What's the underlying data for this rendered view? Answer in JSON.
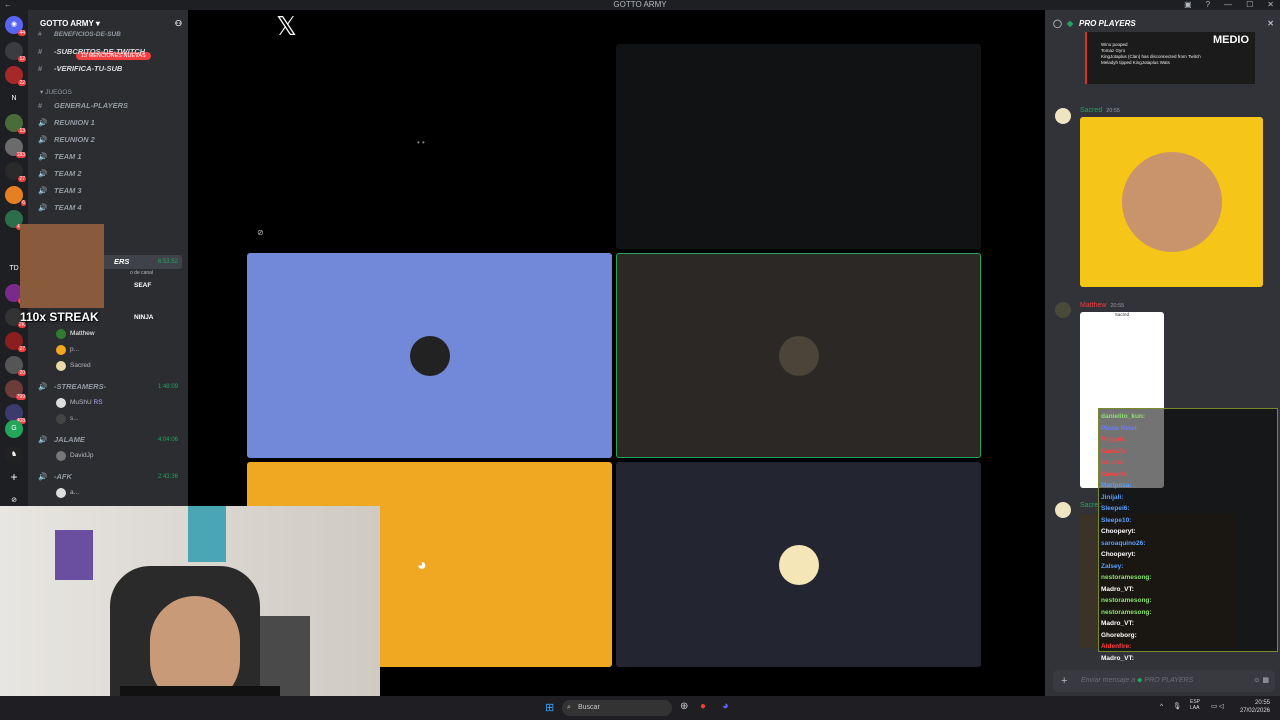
{
  "window": {
    "title": "GOTTO ARMY"
  },
  "server_rail": {
    "badges": [
      "44",
      "12",
      "22",
      "N",
      "13",
      "183",
      "27",
      "6",
      "411",
      "TD",
      "24",
      "2K",
      "27",
      "20",
      "799",
      "408"
    ]
  },
  "channels": {
    "server_name": "GOTTO ARMY",
    "mention_pill": "13 MENCIONES NUEVAS",
    "top_channels": [
      "BENEFICIOS-DE-SUB",
      "-SUBCRITOS-DE-TWITCH",
      "-VERIFICA-TU-SUB"
    ],
    "category": "JUEGOS",
    "text_channels": [
      "GENERAL-PLAYERS"
    ],
    "voice_channels": [
      "REUNION 1",
      "REUNION 2",
      "TEAM 1",
      "TEAM 2",
      "TEAM 3",
      "TEAM 4"
    ],
    "partial_labels": [
      "ERS",
      "SEAF",
      "NINJA"
    ],
    "active_time": "6:53:52",
    "active_sub": "o de canal",
    "pro_players_users": [
      "Matthew",
      "p...",
      "Sacred"
    ],
    "streamers": {
      "name": "-STREAMERS-",
      "time": "1:48:09",
      "users": [
        "MuShU",
        "s..."
      ],
      "badge": "RS"
    },
    "jalame": {
      "name": "JALAME",
      "time": "4:04:06",
      "users": [
        "DavidJp"
      ]
    },
    "afk": {
      "name": "-AFK",
      "time": "2:43:36",
      "users": [
        "a..."
      ]
    }
  },
  "overlay": {
    "streak": "110x STREAK"
  },
  "stage": {
    "tiles": [
      {
        "color": "#000000",
        "label": ""
      },
      {
        "color": "#111214",
        "label": ""
      },
      {
        "color": "#7289da",
        "label": ""
      },
      {
        "color": "#2b2826",
        "label": ""
      },
      {
        "color": "#f0a823",
        "label": ""
      },
      {
        "color": "#232530",
        "label": ""
      }
    ],
    "x_logo": "𝕏"
  },
  "chat": {
    "title": "PRO PLAYERS",
    "image_text": "MEDIO",
    "mini_log": [
      "Wino pooped",
      "Tomaz Gyro",
      "KingJotaplus (Clan) has disconnected from Twitch",
      "Meladyh tipped KingJotaplus Wats"
    ],
    "messages": [
      {
        "author": "Sacred",
        "time": "20:55",
        "color": "#23a55a"
      },
      {
        "author": "Matthew",
        "time": "20:55",
        "color": "#f23f42"
      },
      {
        "author": "Sacred",
        "time": "",
        "color": "#23a55a"
      }
    ],
    "card_name": "Sacred",
    "composer_placeholder": "Enviar mensaje a",
    "composer_channel": "PRO PLAYERS"
  },
  "twitch_chat": [
    {
      "user": "danielito_kun:",
      "color": "#8be36a"
    },
    {
      "user": "Pinna Rinel:",
      "color": "#6d7dff"
    },
    {
      "user": "Mojgan:",
      "color": "#ff4040"
    },
    {
      "user": "Kamafia:",
      "color": "#ff4040"
    },
    {
      "user": "neutral:",
      "color": "#ff4040"
    },
    {
      "user": "Camerlel:",
      "color": "#ff4040"
    },
    {
      "user": "Mariposa:",
      "color": "#56a0ff"
    },
    {
      "user": "Jinijali:",
      "color": "#56a0ff"
    },
    {
      "user": "Sleepei6:",
      "color": "#56a0ff"
    },
    {
      "user": "Sleepe10:",
      "color": "#56a0ff"
    },
    {
      "user": "Chooperyt:",
      "color": "#ffffff"
    },
    {
      "user": "saroaquino26:",
      "color": "#56a0ff"
    },
    {
      "user": "Chooperyt:",
      "color": "#ffffff"
    },
    {
      "user": "Zalsey:",
      "color": "#56a0ff"
    },
    {
      "user": "nestoramesong:",
      "color": "#8be36a"
    },
    {
      "user": "Madro_VT:",
      "color": "#ffffff"
    },
    {
      "user": "nestoramesong:",
      "color": "#8be36a"
    },
    {
      "user": "nestoramesong:",
      "color": "#8be36a"
    },
    {
      "user": "Madro_VT:",
      "color": "#ffffff"
    },
    {
      "user": "Ghoreborg:",
      "color": "#ffffff"
    },
    {
      "user": "Aldenfire:",
      "color": "#ff4040"
    },
    {
      "user": "Madro_VT:",
      "color": "#ffffff"
    }
  ],
  "taskbar": {
    "search": "Buscar",
    "lang": "ESP",
    "lang2": "LAA",
    "time": "20:55",
    "date": "27/02/2026"
  }
}
